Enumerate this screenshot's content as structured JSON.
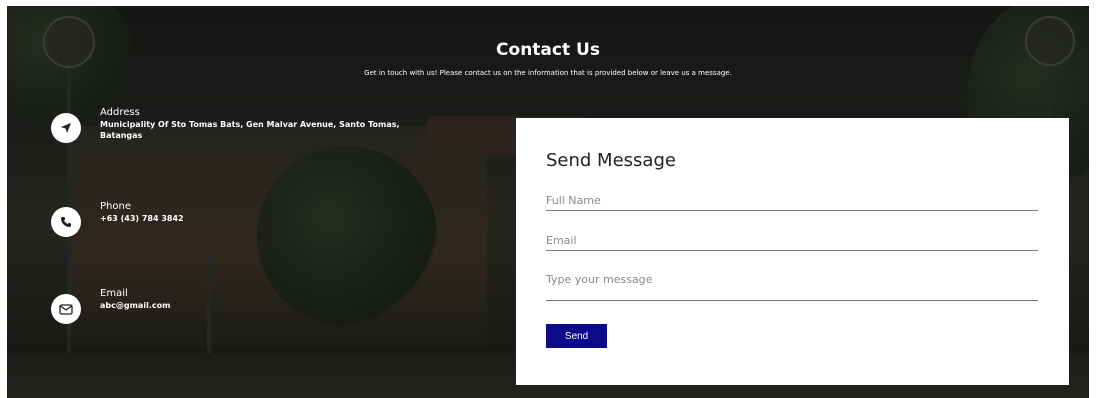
{
  "header": {
    "title": "Contact Us",
    "subtitle": "Get in touch with us! Please contact us on the information that is provided below or leave us a message."
  },
  "contact_info": {
    "address": {
      "label": "Address",
      "value": "Municipality Of Sto Tomas Bats, Gen Malvar Avenue, Santo Tomas, Batangas",
      "icon": "location-arrow-icon"
    },
    "phone": {
      "label": "Phone",
      "value": "+63 (43) 784 3842",
      "icon": "phone-icon"
    },
    "email": {
      "label": "Email",
      "value": "abc@gmail.com",
      "icon": "envelope-icon"
    }
  },
  "form": {
    "title": "Send Message",
    "full_name_placeholder": "Full Name",
    "email_placeholder": "Email",
    "message_placeholder": "Type your message",
    "send_label": "Send"
  },
  "colors": {
    "button": "#0a0a8a",
    "card": "#ffffff",
    "text_light": "#ffffff"
  }
}
